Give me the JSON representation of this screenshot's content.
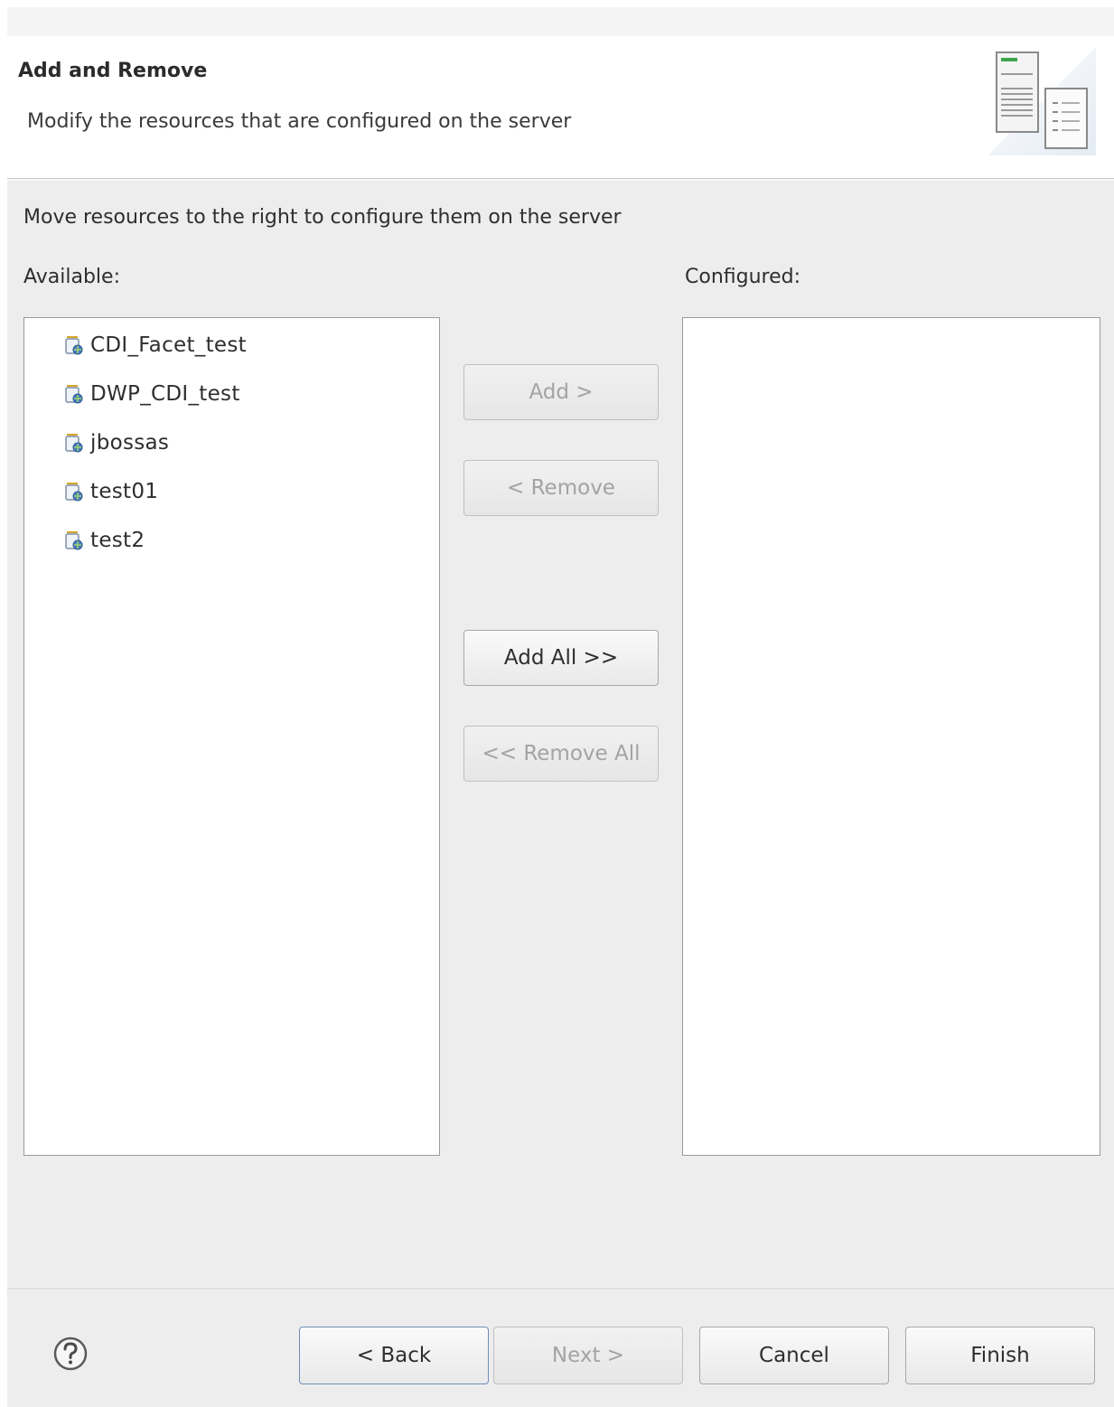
{
  "banner": {
    "title": "Add and Remove",
    "description": "Modify the resources that are configured on the server",
    "icon": "server-icon"
  },
  "instruction": "Move resources to the right to configure them on the server",
  "available": {
    "label": "Available:",
    "items": [
      {
        "label": "CDI_Facet_test",
        "icon": "web-project-icon"
      },
      {
        "label": "DWP_CDI_test",
        "icon": "web-project-icon"
      },
      {
        "label": "jbossas",
        "icon": "web-project-icon"
      },
      {
        "label": "test01",
        "icon": "web-project-icon"
      },
      {
        "label": "test2",
        "icon": "web-project-icon"
      }
    ]
  },
  "configured": {
    "label": "Configured:",
    "items": []
  },
  "transfer_buttons": {
    "add": "Add >",
    "remove": "< Remove",
    "add_all": "Add All >>",
    "remove_all": "<< Remove All"
  },
  "footer": {
    "help_icon": "help-icon",
    "back": "< Back",
    "next": "Next >",
    "cancel": "Cancel",
    "finish": "Finish"
  }
}
